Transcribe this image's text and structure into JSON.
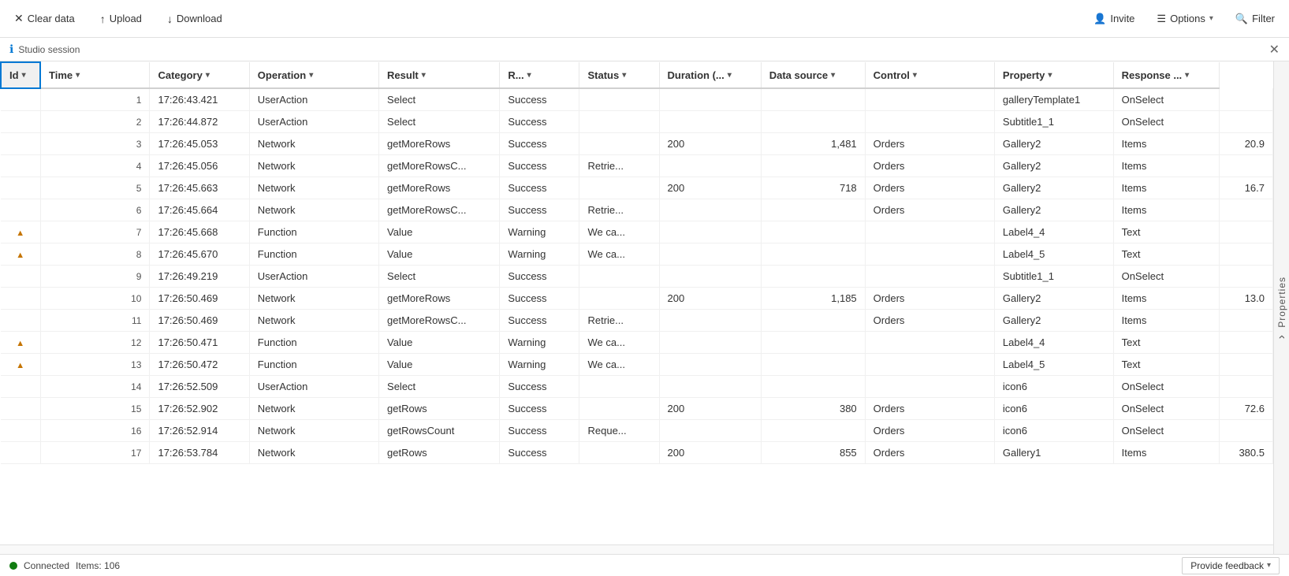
{
  "toolbar": {
    "clear_data_label": "Clear data",
    "upload_label": "Upload",
    "download_label": "Download",
    "invite_label": "Invite",
    "options_label": "Options",
    "filter_label": "Filter"
  },
  "session_bar": {
    "label": "Studio session"
  },
  "side_panel": {
    "label": "Properties"
  },
  "table": {
    "columns": [
      {
        "key": "id",
        "label": "Id",
        "sortable": true
      },
      {
        "key": "time",
        "label": "Time",
        "sortable": true
      },
      {
        "key": "category",
        "label": "Category",
        "sortable": true
      },
      {
        "key": "operation",
        "label": "Operation",
        "sortable": true
      },
      {
        "key": "result",
        "label": "Result",
        "sortable": true
      },
      {
        "key": "r",
        "label": "R...",
        "sortable": true
      },
      {
        "key": "status",
        "label": "Status",
        "sortable": true
      },
      {
        "key": "duration",
        "label": "Duration (...",
        "sortable": true
      },
      {
        "key": "datasource",
        "label": "Data source",
        "sortable": true
      },
      {
        "key": "control",
        "label": "Control",
        "sortable": true
      },
      {
        "key": "property",
        "label": "Property",
        "sortable": true
      },
      {
        "key": "response",
        "label": "Response ...",
        "sortable": true
      }
    ],
    "rows": [
      {
        "id": 1,
        "warn": false,
        "time": "17:26:43.421",
        "category": "UserAction",
        "operation": "Select",
        "result": "Success",
        "r": "",
        "status": "",
        "duration": "",
        "datasource": "",
        "control": "galleryTemplate1",
        "property": "OnSelect",
        "response": ""
      },
      {
        "id": 2,
        "warn": false,
        "time": "17:26:44.872",
        "category": "UserAction",
        "operation": "Select",
        "result": "Success",
        "r": "",
        "status": "",
        "duration": "",
        "datasource": "",
        "control": "Subtitle1_1",
        "property": "OnSelect",
        "response": ""
      },
      {
        "id": 3,
        "warn": false,
        "time": "17:26:45.053",
        "category": "Network",
        "operation": "getMoreRows",
        "result": "Success",
        "r": "",
        "status": "200",
        "duration": "1,481",
        "datasource": "Orders",
        "control": "Gallery2",
        "property": "Items",
        "response": "20.9"
      },
      {
        "id": 4,
        "warn": false,
        "time": "17:26:45.056",
        "category": "Network",
        "operation": "getMoreRowsC...",
        "result": "Success",
        "r": "Retrie...",
        "status": "",
        "duration": "",
        "datasource": "Orders",
        "control": "Gallery2",
        "property": "Items",
        "response": ""
      },
      {
        "id": 5,
        "warn": false,
        "time": "17:26:45.663",
        "category": "Network",
        "operation": "getMoreRows",
        "result": "Success",
        "r": "",
        "status": "200",
        "duration": "718",
        "datasource": "Orders",
        "control": "Gallery2",
        "property": "Items",
        "response": "16.7"
      },
      {
        "id": 6,
        "warn": false,
        "time": "17:26:45.664",
        "category": "Network",
        "operation": "getMoreRowsC...",
        "result": "Success",
        "r": "Retrie...",
        "status": "",
        "duration": "",
        "datasource": "Orders",
        "control": "Gallery2",
        "property": "Items",
        "response": ""
      },
      {
        "id": 7,
        "warn": true,
        "time": "17:26:45.668",
        "category": "Function",
        "operation": "Value",
        "result": "Warning",
        "r": "We ca...",
        "status": "",
        "duration": "",
        "datasource": "",
        "control": "Label4_4",
        "property": "Text",
        "response": ""
      },
      {
        "id": 8,
        "warn": true,
        "time": "17:26:45.670",
        "category": "Function",
        "operation": "Value",
        "result": "Warning",
        "r": "We ca...",
        "status": "",
        "duration": "",
        "datasource": "",
        "control": "Label4_5",
        "property": "Text",
        "response": ""
      },
      {
        "id": 9,
        "warn": false,
        "time": "17:26:49.219",
        "category": "UserAction",
        "operation": "Select",
        "result": "Success",
        "r": "",
        "status": "",
        "duration": "",
        "datasource": "",
        "control": "Subtitle1_1",
        "property": "OnSelect",
        "response": ""
      },
      {
        "id": 10,
        "warn": false,
        "time": "17:26:50.469",
        "category": "Network",
        "operation": "getMoreRows",
        "result": "Success",
        "r": "",
        "status": "200",
        "duration": "1,185",
        "datasource": "Orders",
        "control": "Gallery2",
        "property": "Items",
        "response": "13.0"
      },
      {
        "id": 11,
        "warn": false,
        "time": "17:26:50.469",
        "category": "Network",
        "operation": "getMoreRowsC...",
        "result": "Success",
        "r": "Retrie...",
        "status": "",
        "duration": "",
        "datasource": "Orders",
        "control": "Gallery2",
        "property": "Items",
        "response": ""
      },
      {
        "id": 12,
        "warn": true,
        "time": "17:26:50.471",
        "category": "Function",
        "operation": "Value",
        "result": "Warning",
        "r": "We ca...",
        "status": "",
        "duration": "",
        "datasource": "",
        "control": "Label4_4",
        "property": "Text",
        "response": ""
      },
      {
        "id": 13,
        "warn": true,
        "time": "17:26:50.472",
        "category": "Function",
        "operation": "Value",
        "result": "Warning",
        "r": "We ca...",
        "status": "",
        "duration": "",
        "datasource": "",
        "control": "Label4_5",
        "property": "Text",
        "response": ""
      },
      {
        "id": 14,
        "warn": false,
        "time": "17:26:52.509",
        "category": "UserAction",
        "operation": "Select",
        "result": "Success",
        "r": "",
        "status": "",
        "duration": "",
        "datasource": "",
        "control": "icon6",
        "property": "OnSelect",
        "response": ""
      },
      {
        "id": 15,
        "warn": false,
        "time": "17:26:52.902",
        "category": "Network",
        "operation": "getRows",
        "result": "Success",
        "r": "",
        "status": "200",
        "duration": "380",
        "datasource": "Orders",
        "control": "icon6",
        "property": "OnSelect",
        "response": "72.6"
      },
      {
        "id": 16,
        "warn": false,
        "time": "17:26:52.914",
        "category": "Network",
        "operation": "getRowsCount",
        "result": "Success",
        "r": "Reque...",
        "status": "",
        "duration": "",
        "datasource": "Orders",
        "control": "icon6",
        "property": "OnSelect",
        "response": ""
      },
      {
        "id": 17,
        "warn": false,
        "time": "17:26:53.784",
        "category": "Network",
        "operation": "getRows",
        "result": "Success",
        "r": "",
        "status": "200",
        "duration": "855",
        "datasource": "Orders",
        "control": "Gallery1",
        "property": "Items",
        "response": "380.5"
      }
    ]
  },
  "status_bar": {
    "connected_label": "Connected",
    "items_label": "Items: 106",
    "feedback_label": "Provide feedback"
  }
}
